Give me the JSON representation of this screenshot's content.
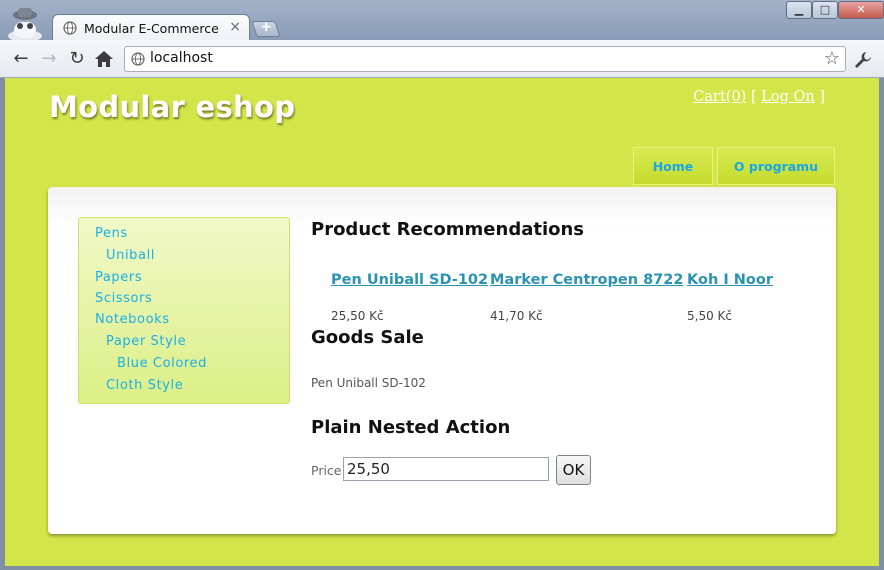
{
  "browser": {
    "tab_title": "Modular E-Commerce",
    "tab_close": "×",
    "new_tab": "+",
    "url": "localhost",
    "window_controls": {
      "minimize": "▁",
      "maximize": "□",
      "close": "✕"
    },
    "icons": [
      "incognito-icon",
      "globe-icon",
      "back-icon",
      "forward-icon",
      "reload-icon",
      "home-icon",
      "star-icon",
      "wrench-icon"
    ]
  },
  "site": {
    "title": "Modular eshop",
    "cart_label": "Cart(0)",
    "bracket_open": "[",
    "login_label": "Log On",
    "bracket_close": "]",
    "menu": [
      {
        "label": "Home"
      },
      {
        "label": "O programu"
      }
    ]
  },
  "categories": [
    {
      "label": "Pens",
      "level": 0
    },
    {
      "label": "Uniball",
      "level": 1
    },
    {
      "label": "Papers",
      "level": 0
    },
    {
      "label": "Scissors",
      "level": 0
    },
    {
      "label": "Notebooks",
      "level": 0
    },
    {
      "label": "Paper Style",
      "level": 1
    },
    {
      "label": "Blue Colored",
      "level": 2
    },
    {
      "label": "Cloth Style",
      "level": 1
    }
  ],
  "recommendations": {
    "title": "Product Recommendations",
    "items": [
      {
        "name": "Pen Uniball SD-102",
        "price": "25,50 Kč"
      },
      {
        "name": "Marker Centropen 8722",
        "price": "41,70 Kč"
      },
      {
        "name": "Koh I Noor",
        "price": "5,50 Kč"
      }
    ]
  },
  "goods_sale": {
    "title": "Goods Sale",
    "item": "Pen Uniball SD-102"
  },
  "plain_nested_action": {
    "title": "Plain Nested Action",
    "price_label": "Price",
    "price_value": "25,50",
    "ok_label": "OK"
  },
  "colors": {
    "page_bg": "#d2e649",
    "link": "#2a93b3",
    "category": "#1ab0e8",
    "menu_text": "#1aa7e6"
  }
}
